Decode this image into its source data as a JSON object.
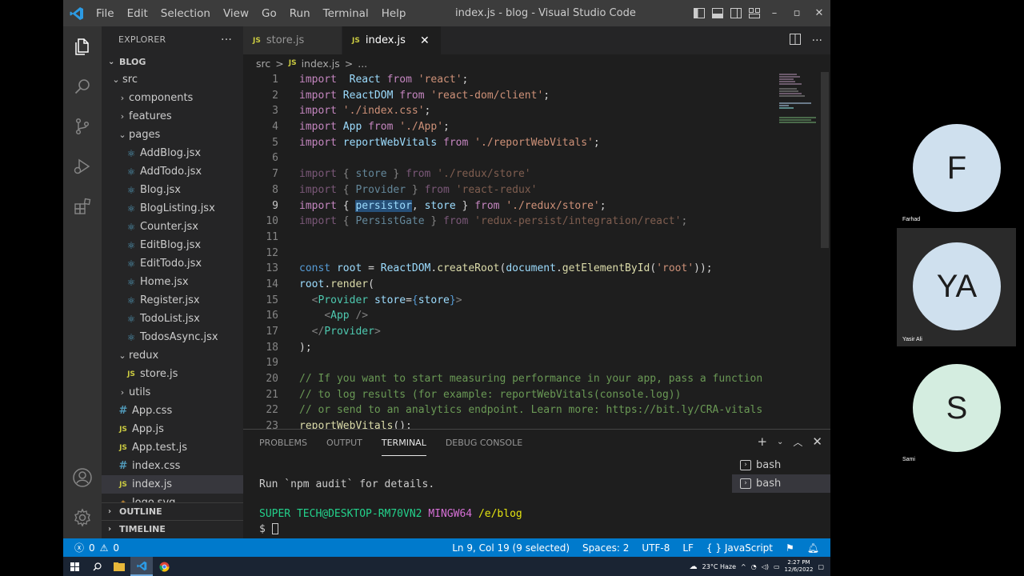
{
  "window": {
    "title": "index.js - blog - Visual Studio Code",
    "menu": [
      "File",
      "Edit",
      "Selection",
      "View",
      "Go",
      "Run",
      "Terminal",
      "Help"
    ]
  },
  "explorer": {
    "header": "EXPLORER",
    "root": "BLOG",
    "tree": [
      {
        "label": "src",
        "kind": "folder-open",
        "depth": 1
      },
      {
        "label": "components",
        "kind": "folder-closed",
        "depth": 2
      },
      {
        "label": "features",
        "kind": "folder-closed",
        "depth": 2
      },
      {
        "label": "pages",
        "kind": "folder-open",
        "depth": 2
      },
      {
        "label": "AddBlog.jsx",
        "kind": "react",
        "depth": 3
      },
      {
        "label": "AddTodo.jsx",
        "kind": "react",
        "depth": 3
      },
      {
        "label": "Blog.jsx",
        "kind": "react",
        "depth": 3
      },
      {
        "label": "BlogListing.jsx",
        "kind": "react",
        "depth": 3
      },
      {
        "label": "Counter.jsx",
        "kind": "react",
        "depth": 3
      },
      {
        "label": "EditBlog.jsx",
        "kind": "react",
        "depth": 3
      },
      {
        "label": "EditTodo.jsx",
        "kind": "react",
        "depth": 3
      },
      {
        "label": "Home.jsx",
        "kind": "react",
        "depth": 3
      },
      {
        "label": "Register.jsx",
        "kind": "react",
        "depth": 3
      },
      {
        "label": "TodoList.jsx",
        "kind": "react",
        "depth": 3
      },
      {
        "label": "TodosAsync.jsx",
        "kind": "react",
        "depth": 3
      },
      {
        "label": "redux",
        "kind": "folder-open",
        "depth": 2
      },
      {
        "label": "store.js",
        "kind": "js",
        "depth": 3
      },
      {
        "label": "utils",
        "kind": "folder-closed",
        "depth": 2
      },
      {
        "label": "App.css",
        "kind": "css",
        "depth": 2
      },
      {
        "label": "App.js",
        "kind": "js",
        "depth": 2
      },
      {
        "label": "App.test.js",
        "kind": "js",
        "depth": 2
      },
      {
        "label": "index.css",
        "kind": "css",
        "depth": 2
      },
      {
        "label": "index.js",
        "kind": "js",
        "depth": 2,
        "selected": true
      },
      {
        "label": "logo.svg",
        "kind": "svg",
        "depth": 2
      }
    ],
    "outline": "OUTLINE",
    "timeline": "TIMELINE"
  },
  "tabs": [
    {
      "icon": "JS",
      "label": "store.js",
      "active": false
    },
    {
      "icon": "JS",
      "label": "index.js",
      "active": true
    }
  ],
  "breadcrumb": {
    "folder": "src",
    "sep": ">",
    "file": "index.js",
    "more": "..."
  },
  "code": {
    "current_line": 9,
    "lines": [
      {
        "n": "1",
        "t": [
          [
            "kw",
            "import"
          ],
          [
            "",
            "  "
          ],
          [
            "var",
            "React"
          ],
          [
            "",
            " "
          ],
          [
            "kw",
            "from"
          ],
          [
            "",
            " "
          ],
          [
            "str",
            "'react'"
          ],
          [
            "",
            ";"
          ]
        ]
      },
      {
        "n": "2",
        "t": [
          [
            "kw",
            "import"
          ],
          [
            "",
            " "
          ],
          [
            "var",
            "ReactDOM"
          ],
          [
            "",
            " "
          ],
          [
            "kw",
            "from"
          ],
          [
            "",
            " "
          ],
          [
            "str",
            "'react-dom/client'"
          ],
          [
            "",
            ";"
          ]
        ]
      },
      {
        "n": "3",
        "t": [
          [
            "kw",
            "import"
          ],
          [
            "",
            " "
          ],
          [
            "str",
            "'./index.css'"
          ],
          [
            "",
            ";"
          ]
        ]
      },
      {
        "n": "4",
        "t": [
          [
            "kw",
            "import"
          ],
          [
            "",
            " "
          ],
          [
            "var",
            "App"
          ],
          [
            "",
            " "
          ],
          [
            "kw",
            "from"
          ],
          [
            "",
            " "
          ],
          [
            "str",
            "'./App'"
          ],
          [
            "",
            ";"
          ]
        ]
      },
      {
        "n": "5",
        "t": [
          [
            "kw",
            "import"
          ],
          [
            "",
            " "
          ],
          [
            "var",
            "reportWebVitals"
          ],
          [
            "",
            " "
          ],
          [
            "kw",
            "from"
          ],
          [
            "",
            " "
          ],
          [
            "str",
            "'./reportWebVitals'"
          ],
          [
            "",
            ";"
          ]
        ]
      },
      {
        "n": "6",
        "t": []
      },
      {
        "n": "7",
        "t": [
          [
            "kw dim",
            "import"
          ],
          [
            "dim",
            " { "
          ],
          [
            "var dim",
            "store"
          ],
          [
            "dim",
            " } "
          ],
          [
            "kw dim",
            "from"
          ],
          [
            "",
            " "
          ],
          [
            "str dim",
            "'./redux/store'"
          ]
        ]
      },
      {
        "n": "8",
        "t": [
          [
            "kw dim",
            "import"
          ],
          [
            "dim",
            " { "
          ],
          [
            "var dim",
            "Provider"
          ],
          [
            "dim",
            " } "
          ],
          [
            "kw dim",
            "from"
          ],
          [
            "",
            " "
          ],
          [
            "str dim",
            "'react-redux'"
          ]
        ]
      },
      {
        "n": "9",
        "t": [
          [
            "kw",
            "import"
          ],
          [
            "",
            " { "
          ],
          [
            "var sel",
            "persistor"
          ],
          [
            "",
            ", "
          ],
          [
            "var",
            "store"
          ],
          [
            "",
            " } "
          ],
          [
            "kw",
            "from"
          ],
          [
            "",
            " "
          ],
          [
            "str",
            "'./redux/store'"
          ],
          [
            "",
            ";"
          ]
        ]
      },
      {
        "n": "10",
        "t": [
          [
            "kw dim",
            "import"
          ],
          [
            "dim",
            " { "
          ],
          [
            "var dim",
            "PersistGate"
          ],
          [
            "dim",
            " } "
          ],
          [
            "kw dim",
            "from"
          ],
          [
            "",
            " "
          ],
          [
            "str dim",
            "'redux-persist/integration/react'"
          ],
          [
            "dim",
            ";"
          ]
        ]
      },
      {
        "n": "11",
        "t": []
      },
      {
        "n": "12",
        "t": []
      },
      {
        "n": "13",
        "t": [
          [
            "blue",
            "const"
          ],
          [
            "",
            " "
          ],
          [
            "var",
            "root"
          ],
          [
            "",
            " = "
          ],
          [
            "var",
            "ReactDOM"
          ],
          [
            "",
            "."
          ],
          [
            "fn",
            "createRoot"
          ],
          [
            "",
            "("
          ],
          [
            "var",
            "document"
          ],
          [
            "",
            "."
          ],
          [
            "fn",
            "getElementById"
          ],
          [
            "",
            "("
          ],
          [
            "str",
            "'root'"
          ],
          [
            "",
            "));"
          ]
        ]
      },
      {
        "n": "14",
        "t": [
          [
            "var",
            "root"
          ],
          [
            "",
            "."
          ],
          [
            "fn",
            "render"
          ],
          [
            "",
            "("
          ]
        ]
      },
      {
        "n": "15",
        "t": [
          [
            "",
            "  "
          ],
          [
            "tag",
            "<"
          ],
          [
            "typ",
            "Provider"
          ],
          [
            "",
            " "
          ],
          [
            "var",
            "store"
          ],
          [
            "",
            "="
          ],
          [
            "blue",
            "{"
          ],
          [
            "var",
            "store"
          ],
          [
            "blue",
            "}"
          ],
          [
            "tag",
            ">"
          ]
        ]
      },
      {
        "n": "16",
        "t": [
          [
            "",
            "    "
          ],
          [
            "tag",
            "<"
          ],
          [
            "typ",
            "App"
          ],
          [
            "",
            " "
          ],
          [
            "tag",
            "/>"
          ]
        ]
      },
      {
        "n": "17",
        "t": [
          [
            "",
            "  "
          ],
          [
            "tag",
            "</"
          ],
          [
            "typ",
            "Provider"
          ],
          [
            "tag",
            ">"
          ]
        ]
      },
      {
        "n": "18",
        "t": [
          [
            "",
            ");"
          ]
        ]
      },
      {
        "n": "19",
        "t": []
      },
      {
        "n": "20",
        "t": [
          [
            "cmt",
            "// If you want to start measuring performance in your app, pass a function"
          ]
        ]
      },
      {
        "n": "21",
        "t": [
          [
            "cmt",
            "// to log results (for example: reportWebVitals(console.log))"
          ]
        ]
      },
      {
        "n": "22",
        "t": [
          [
            "cmt",
            "// or send to an analytics endpoint. Learn more: https://bit.ly/CRA-vitals"
          ]
        ]
      },
      {
        "n": "23",
        "t": [
          [
            "fn",
            "reportWebVitals"
          ],
          [
            "",
            "();"
          ]
        ]
      }
    ]
  },
  "panel": {
    "tabs": [
      "PROBLEMS",
      "OUTPUT",
      "TERMINAL",
      "DEBUG CONSOLE"
    ],
    "active_tab": "TERMINAL",
    "terminal": {
      "line1": "Run `npm audit` for details.",
      "prompt_user": "SUPER TECH@DESKTOP-RM70VN2",
      "prompt_env": "MINGW64",
      "prompt_path": "/e/blog",
      "prompt_symbol": "$"
    },
    "terminals": [
      "bash",
      "bash"
    ]
  },
  "status": {
    "errors": "0",
    "warnings": "0",
    "position": "Ln 9, Col 19 (9 selected)",
    "spaces": "Spaces: 2",
    "encoding": "UTF-8",
    "eol": "LF",
    "language": "JavaScript",
    "language_icon": "{ }"
  },
  "taskbar": {
    "weather": "23°C  Haze",
    "time": "2:27 PM",
    "date": "12/6/2022"
  },
  "participants": [
    {
      "initials": "F",
      "name": "Farhad",
      "color": "#cfe0ee"
    },
    {
      "initials": "YA",
      "name": "Yasir Ali",
      "color": "#cfe0ee"
    },
    {
      "initials": "S",
      "name": "Sami",
      "color": "#d4ede0"
    }
  ],
  "colors": {
    "accent": "#007acc",
    "editor_bg": "#1e1e1e",
    "sidebar_bg": "#252526"
  }
}
